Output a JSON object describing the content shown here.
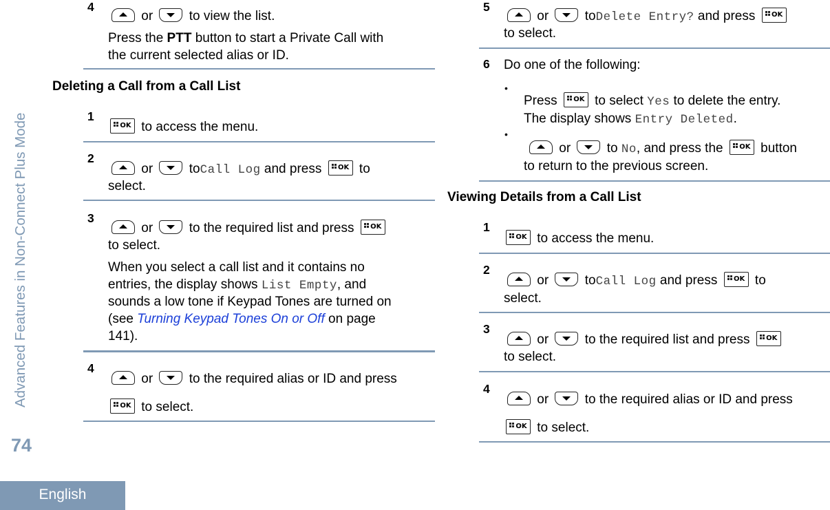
{
  "sidebar": {
    "chapter_title": "Advanced Features in Non-Connect Plus Mode",
    "page_number": "74",
    "language": "English"
  },
  "left_column": {
    "prev_step": {
      "num": "4",
      "line1_or": "or",
      "line1_text": "to view the list.",
      "note_prefix": "Press the ",
      "note_bold": "PTT",
      "note_suffix": " button to start a Private Call with",
      "note_line2": "the current selected alias or ID."
    },
    "section_title": "Deleting a Call from a Call List",
    "steps": [
      {
        "num": "1",
        "text": "to access the menu."
      },
      {
        "num": "2",
        "or": "or",
        "to": "to",
        "display": "Call Log",
        "mid": "and press",
        "end": "to",
        "line2": "select."
      },
      {
        "num": "3",
        "or": "or",
        "text": "to the required list and press",
        "line2": "to select.",
        "note_l1": "When you select a call list and it contains no",
        "note_l2_prefix": "entries, the display shows ",
        "note_l2_display": "List Empty",
        "note_l2_suffix": ", and",
        "note_l3": "sounds a low tone if Keypad Tones are turned on",
        "note_l4_prefix": "(see ",
        "note_l4_link": "Turning Keypad Tones On or Off",
        "note_l4_suffix": " on page",
        "note_l5": "141)."
      },
      {
        "num": "4",
        "or": "or",
        "text": "to the required alias or ID and press",
        "line2": "to select."
      }
    ]
  },
  "right_column": {
    "steps_cont": [
      {
        "num": "5",
        "or": "or",
        "to": "to",
        "display": "Delete Entry?",
        "mid": "and press",
        "line2": "to select."
      },
      {
        "num": "6",
        "text": "Do one of the following:",
        "bullets": [
          {
            "prefix": "Press",
            "mid": "to select",
            "display": "Yes",
            "suffix": "to delete the entry.",
            "line2_prefix": "The display shows ",
            "line2_display": "Entry Deleted",
            "line2_suffix": "."
          },
          {
            "or": "or",
            "to": "to",
            "display": "No",
            "mid": ", and press the",
            "end": "button",
            "line2": "to return to the previous screen."
          }
        ]
      }
    ],
    "section_title": "Viewing Details from a Call List",
    "steps": [
      {
        "num": "1",
        "text": "to access the menu."
      },
      {
        "num": "2",
        "or": "or",
        "to": "to",
        "display": "Call Log",
        "mid": "and press",
        "end": "to",
        "line2": "select."
      },
      {
        "num": "3",
        "or": "or",
        "text": "to the required list and press",
        "line2": "to select."
      },
      {
        "num": "4",
        "or": "or",
        "text": "to the required alias or ID and press",
        "line2": "to select."
      }
    ]
  },
  "icons": {
    "ok_label": "OK"
  },
  "colors": {
    "accent": "#7f99b4",
    "link": "#1b3fd8"
  }
}
